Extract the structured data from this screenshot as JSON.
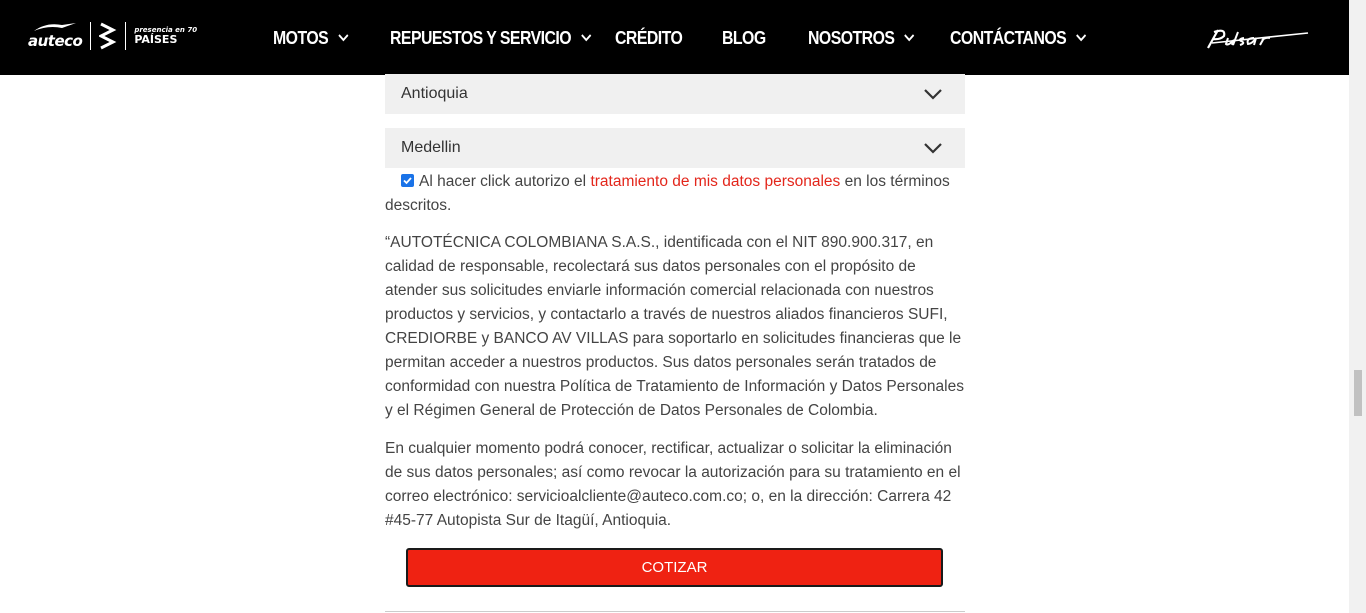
{
  "header": {
    "brand": {
      "auteco": "auteco",
      "bajaj": "BAJAJ",
      "presencia_top": "presencia en 70",
      "presencia_bottom": "PAÍSES",
      "pulsar": "pulsar"
    },
    "nav": [
      {
        "label": "MOTOS",
        "has_dropdown": true
      },
      {
        "label": "REPUESTOS Y SERVICIO",
        "has_dropdown": true
      },
      {
        "label": "CRÉDITO",
        "has_dropdown": false
      },
      {
        "label": "BLOG",
        "has_dropdown": false
      },
      {
        "label": "NOSOTROS",
        "has_dropdown": true
      },
      {
        "label": "CONTÁCTANOS",
        "has_dropdown": true
      }
    ]
  },
  "form": {
    "department_value": "Antioquia",
    "city_value": "Medellin",
    "consent": {
      "checked": true,
      "text_before": "Al hacer click autorizo el ",
      "link_text": "tratamiento de mis datos personales",
      "text_after": " en los términos descritos."
    },
    "paragraph_1": "“AUTOTÉCNICA COLOMBIANA S.A.S., identificada con el NIT 890.900.317, en calidad de responsable, recolectará sus datos personales con el propósito de atender sus solicitudes enviarle información comercial relacionada con nuestros productos y servicios, y contactarlo a través de nuestros aliados financieros SUFI, CREDIORBE y BANCO AV VILLAS para soportarlo en solicitudes financieras que le permitan acceder a nuestros productos. Sus datos personales serán tratados de conformidad con nuestra Política de Tratamiento de Información y Datos Personales y el Régimen General de Protección de Datos Personales de Colombia.",
    "paragraph_2": "En cualquier momento podrá conocer, rectificar, actualizar o solicitar la eliminación de sus datos personales; así como revocar la autorización para su tratamiento en el correo electrónico: servicioalcliente@auteco.com.co; o, en la dirección: Carrera 42 #45-77 Autopista Sur de Itagüí, Antioquia.",
    "submit_label": "COTIZAR"
  },
  "colors": {
    "header_bg": "#000000",
    "accent_red": "#ef2212",
    "link_red": "#e3261b",
    "select_bg": "#f0f0f0",
    "checkbox": "#1a73e8"
  },
  "icons": {
    "dropdown": "chevron-down-icon",
    "checkbox": "check-icon"
  }
}
